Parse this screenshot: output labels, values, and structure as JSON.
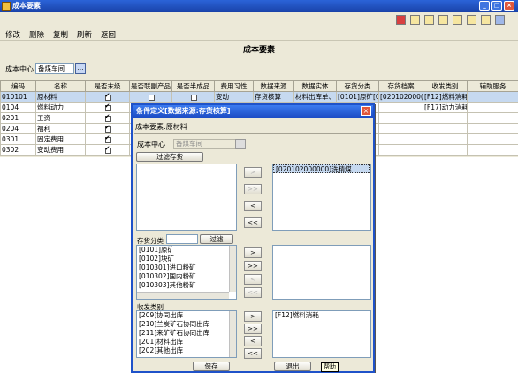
{
  "window": {
    "title": "成本要素"
  },
  "menu": {
    "edit": "修改",
    "delete": "删除",
    "copy": "复制",
    "refresh": "刷新",
    "back": "返回"
  },
  "page": {
    "title": "成本要素"
  },
  "filter": {
    "label": "成本中心",
    "value": "备煤车间"
  },
  "grid": {
    "headers": [
      "编码",
      "名称",
      "是否末级",
      "是否联副产品",
      "是否半成品",
      "费用习性",
      "数据来源",
      "数据实体",
      "存货分类",
      "存货档案",
      "收发类别",
      "辅助服务"
    ],
    "rows": [
      {
        "code": "010101",
        "name": "原材料",
        "last": true,
        "joint": false,
        "semi": false,
        "habit": "变动",
        "source": "存货核算",
        "entity": "材料出库单、",
        "cat": "[0101]原矿[0",
        "arch": "[020102000(",
        "type": "[F12]燃料消耗",
        "aux": ""
      },
      {
        "code": "0104",
        "name": "燃料动力",
        "last": true,
        "joint": false,
        "semi": false,
        "habit": "",
        "source": "",
        "entity": "",
        "cat": "",
        "arch": "",
        "type": "[F17]动力消耗",
        "aux": ""
      },
      {
        "code": "0201",
        "name": "工资",
        "last": true,
        "joint": false,
        "semi": false,
        "habit": "",
        "source": "",
        "entity": "",
        "cat": "",
        "arch": "",
        "type": "",
        "aux": ""
      },
      {
        "code": "0204",
        "name": "福利",
        "last": true,
        "joint": false,
        "semi": false,
        "habit": "",
        "source": "",
        "entity": "",
        "cat": "",
        "arch": "",
        "type": "",
        "aux": ""
      },
      {
        "code": "0301",
        "name": "固定费用",
        "last": true,
        "joint": false,
        "semi": false,
        "habit": "",
        "source": "",
        "entity": "",
        "cat": "",
        "arch": "",
        "type": "",
        "aux": ""
      },
      {
        "code": "0302",
        "name": "变动费用",
        "last": true,
        "joint": false,
        "semi": false,
        "habit": "",
        "source": "",
        "entity": "",
        "cat": "",
        "arch": "",
        "type": "",
        "aux": ""
      }
    ]
  },
  "dialog": {
    "title": "条件定义[数据来源:存货核算]",
    "element": "成本要素:原材料",
    "center_label": "成本中心",
    "center_value": "备煤车间",
    "filter_stock_button": "过滤存货",
    "selected_stock": [
      "[020102000000]洗精煤"
    ],
    "category_label": "存货分类",
    "category_filter_button": "过滤",
    "categories": [
      "[0101]原矿",
      "[0102]块矿",
      "[010301]进口粉矿",
      "[010302]国内粉矿",
      "[010303]其他粉矿"
    ],
    "type_label": "收发类别",
    "types": [
      "[209]协同出库",
      "[210]兰炭矿石协同出库",
      "[211]来矿矿石协同出库",
      "[201]材料出库",
      "[202]其他出库"
    ],
    "selected_types": [
      "[F12]燃料消耗"
    ],
    "arrows": {
      "add": ">",
      "add_all": ">>",
      "remove": "<",
      "remove_all": "<<"
    },
    "save_button": "保存",
    "exit_button": "退出",
    "help_tooltip": "帮助"
  }
}
